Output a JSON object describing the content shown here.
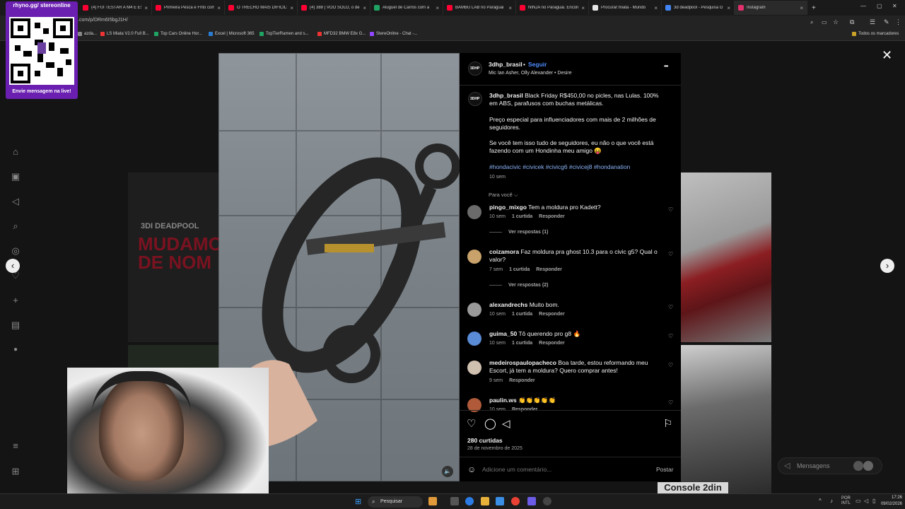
{
  "browser": {
    "tabs": [
      {
        "label": "(4) FUI TESTAR A M4 E ES",
        "color": "#ff0033"
      },
      {
        "label": "Primeira Pesca e Frito com",
        "color": "#ff0033"
      },
      {
        "label": "O TRECHO MAIS DIFÍCIL!",
        "color": "#ff0033"
      },
      {
        "label": "(4) 388 | VOO SOLO, o de",
        "color": "#ff0033"
      },
      {
        "label": "Aluguel de Carros com a",
        "color": "#1fa463"
      },
      {
        "label": "BAMBU LAB no Paraguai",
        "color": "#ff0033"
      },
      {
        "label": "NINJA no Paraguai. Encon",
        "color": "#ff0033"
      },
      {
        "label": "Procurar:miata - Mundo",
        "color": "#e5e5e5"
      },
      {
        "label": "3d deadpool - Pesquisa G",
        "color": "#4285f4"
      },
      {
        "label": "Instagram",
        "color": "#e1306c"
      }
    ],
    "url": ".com/p/DRm6I5bgJ1H/",
    "bookmarks": [
      {
        "label": "azda...",
        "color": "#888888"
      },
      {
        "label": "LS Miata V2.0 Full B...",
        "color": "#e33"
      },
      {
        "label": "Top Cars Online Hor...",
        "color": "#1fa463"
      },
      {
        "label": "Excel | Microsoft 365",
        "color": "#2b7cd3"
      },
      {
        "label": "TopTierRamen and s...",
        "color": "#1fa463"
      },
      {
        "label": "MFD32 BMW E8x G...",
        "color": "#e33"
      },
      {
        "label": "StereOnline - Chat -...",
        "color": "#9146ff"
      }
    ],
    "all_bookmarks": "Todos os marcadores"
  },
  "overlay": {
    "qr_title": "rhyno.gg/ stereonline",
    "qr_footer": "Envie mensagem na live!"
  },
  "post": {
    "username": "3dhp_brasil",
    "dot": "•",
    "follow": "Seguir",
    "audio": "Mic Ian Asher, Olly Alexander • Desire",
    "more": "•••",
    "caption_user": "3dhp_brasil",
    "caption_p1": "Black Friday R$450,00 no picles, nas Lulas. 100% em ABS, parafusos com buchas metálicas.",
    "caption_p2": "Preço especial para influenciadores com mais de 2 milhões de seguidores.",
    "caption_p3": "Se você tem isso tudo de seguidores, eu não o que você está fazendo com um Hondinha meu amigo 😝",
    "hashtags": "#hondacivic #civicek #civicg6 #civicej8 #hondanation",
    "caption_time": "10 sem",
    "filter": "Para você ⌵",
    "comments": [
      {
        "user": "pingo_mixgo",
        "text": "Tem a moldura pro Kadett?",
        "time": "10 sem",
        "likes": "1 curtida",
        "reply": "Responder",
        "replies": "Ver respostas (1)"
      },
      {
        "user": "coizamora",
        "text": "Faz moldura pra ghost 10.3 para o civic g5? Qual o valor?",
        "time": "7 sem",
        "likes": "1 curtida",
        "reply": "Responder",
        "replies": "Ver respostas (2)"
      },
      {
        "user": "alexandrechs",
        "text": "Muito bom.",
        "time": "10 sem",
        "likes": "1 curtida",
        "reply": "Responder",
        "replies": ""
      },
      {
        "user": "guima_50",
        "text": "Tô querendo pro g8 🔥",
        "time": "10 sem",
        "likes": "1 curtida",
        "reply": "Responder",
        "replies": ""
      },
      {
        "user": "medeirospaulopacheco",
        "text": "Boa tarde, estou reformando meu Escort, já tem a moldura? Quero comprar antes!",
        "time": "9 sem",
        "likes": "",
        "reply": "Responder",
        "replies": ""
      },
      {
        "user": "paulin.ws",
        "text": "👏👏👏👏👏",
        "time": "10 sem",
        "likes": "",
        "reply": "Responder",
        "replies": ""
      }
    ],
    "likes_total": "280 curtidas",
    "date": "28 de novembro de 2025",
    "comment_placeholder": "Adicione um comentário...",
    "post_button": "Postar"
  },
  "background": {
    "deadpool_label": "3DI DEADPOOL",
    "deadpool_big": "MUDAMO DE NOM",
    "console_label": "Console 2din",
    "messages": "Mensagens"
  },
  "taskbar": {
    "search": "Pesquisar",
    "lang": "POR INTL",
    "time": "17:26",
    "date": "09/02/2026"
  },
  "colors": {
    "link": "#8ab4f8",
    "follow": "#4f8cff"
  }
}
